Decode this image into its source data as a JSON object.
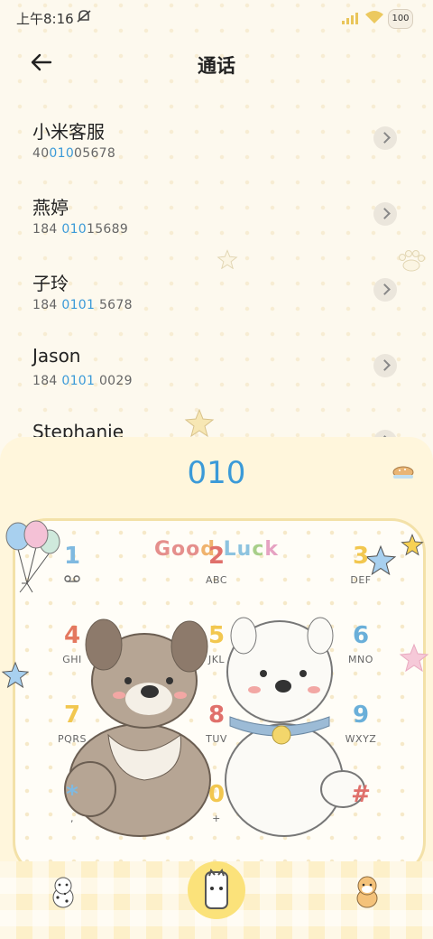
{
  "status_bar": {
    "time": "上午8:16",
    "battery": "100"
  },
  "header": {
    "title": "通话"
  },
  "contacts": [
    {
      "name": "小米客服",
      "num_pre": "40",
      "num_hl": "010",
      "num_post": "05678"
    },
    {
      "name": "燕婷",
      "num_pre": "184 ",
      "num_hl": "010",
      "num_post": "15689"
    },
    {
      "name": "子玲",
      "num_pre": "184 ",
      "num_hl": "0101",
      "num_post": " 5678"
    },
    {
      "name": "Jason",
      "num_pre": "184 ",
      "num_hl": "0101",
      "num_post": " 0029"
    },
    {
      "name": "Stephanie",
      "num_pre": "",
      "num_hl": "",
      "num_post": ""
    }
  ],
  "dialer": {
    "display": "010",
    "banner": [
      "Goo",
      "d",
      " Lu",
      "c",
      "k"
    ],
    "keys": [
      {
        "digit": "1",
        "letters": "",
        "icon": "voicemail-icon"
      },
      {
        "digit": "2",
        "letters": "ABC"
      },
      {
        "digit": "3",
        "letters": "DEF"
      },
      {
        "digit": "4",
        "letters": "GHI"
      },
      {
        "digit": "5",
        "letters": "JKL"
      },
      {
        "digit": "6",
        "letters": "MNO"
      },
      {
        "digit": "7",
        "letters": "PQRS"
      },
      {
        "digit": "8",
        "letters": "TUV"
      },
      {
        "digit": "9",
        "letters": "WXYZ"
      },
      {
        "digit": "*",
        "letters": ","
      },
      {
        "digit": "0",
        "letters": "+"
      },
      {
        "digit": "#",
        "letters": ""
      }
    ]
  },
  "colors": {
    "accent": "#3b9ad8",
    "digits": [
      "#7fb9e0",
      "#e0706b",
      "#f2c74f",
      "#e4785f",
      "#f2c74f",
      "#6aafd9",
      "#f2c74f",
      "#e0706b",
      "#6aafd9",
      "#7fb9e0",
      "#f2c74f",
      "#e0706b"
    ]
  }
}
